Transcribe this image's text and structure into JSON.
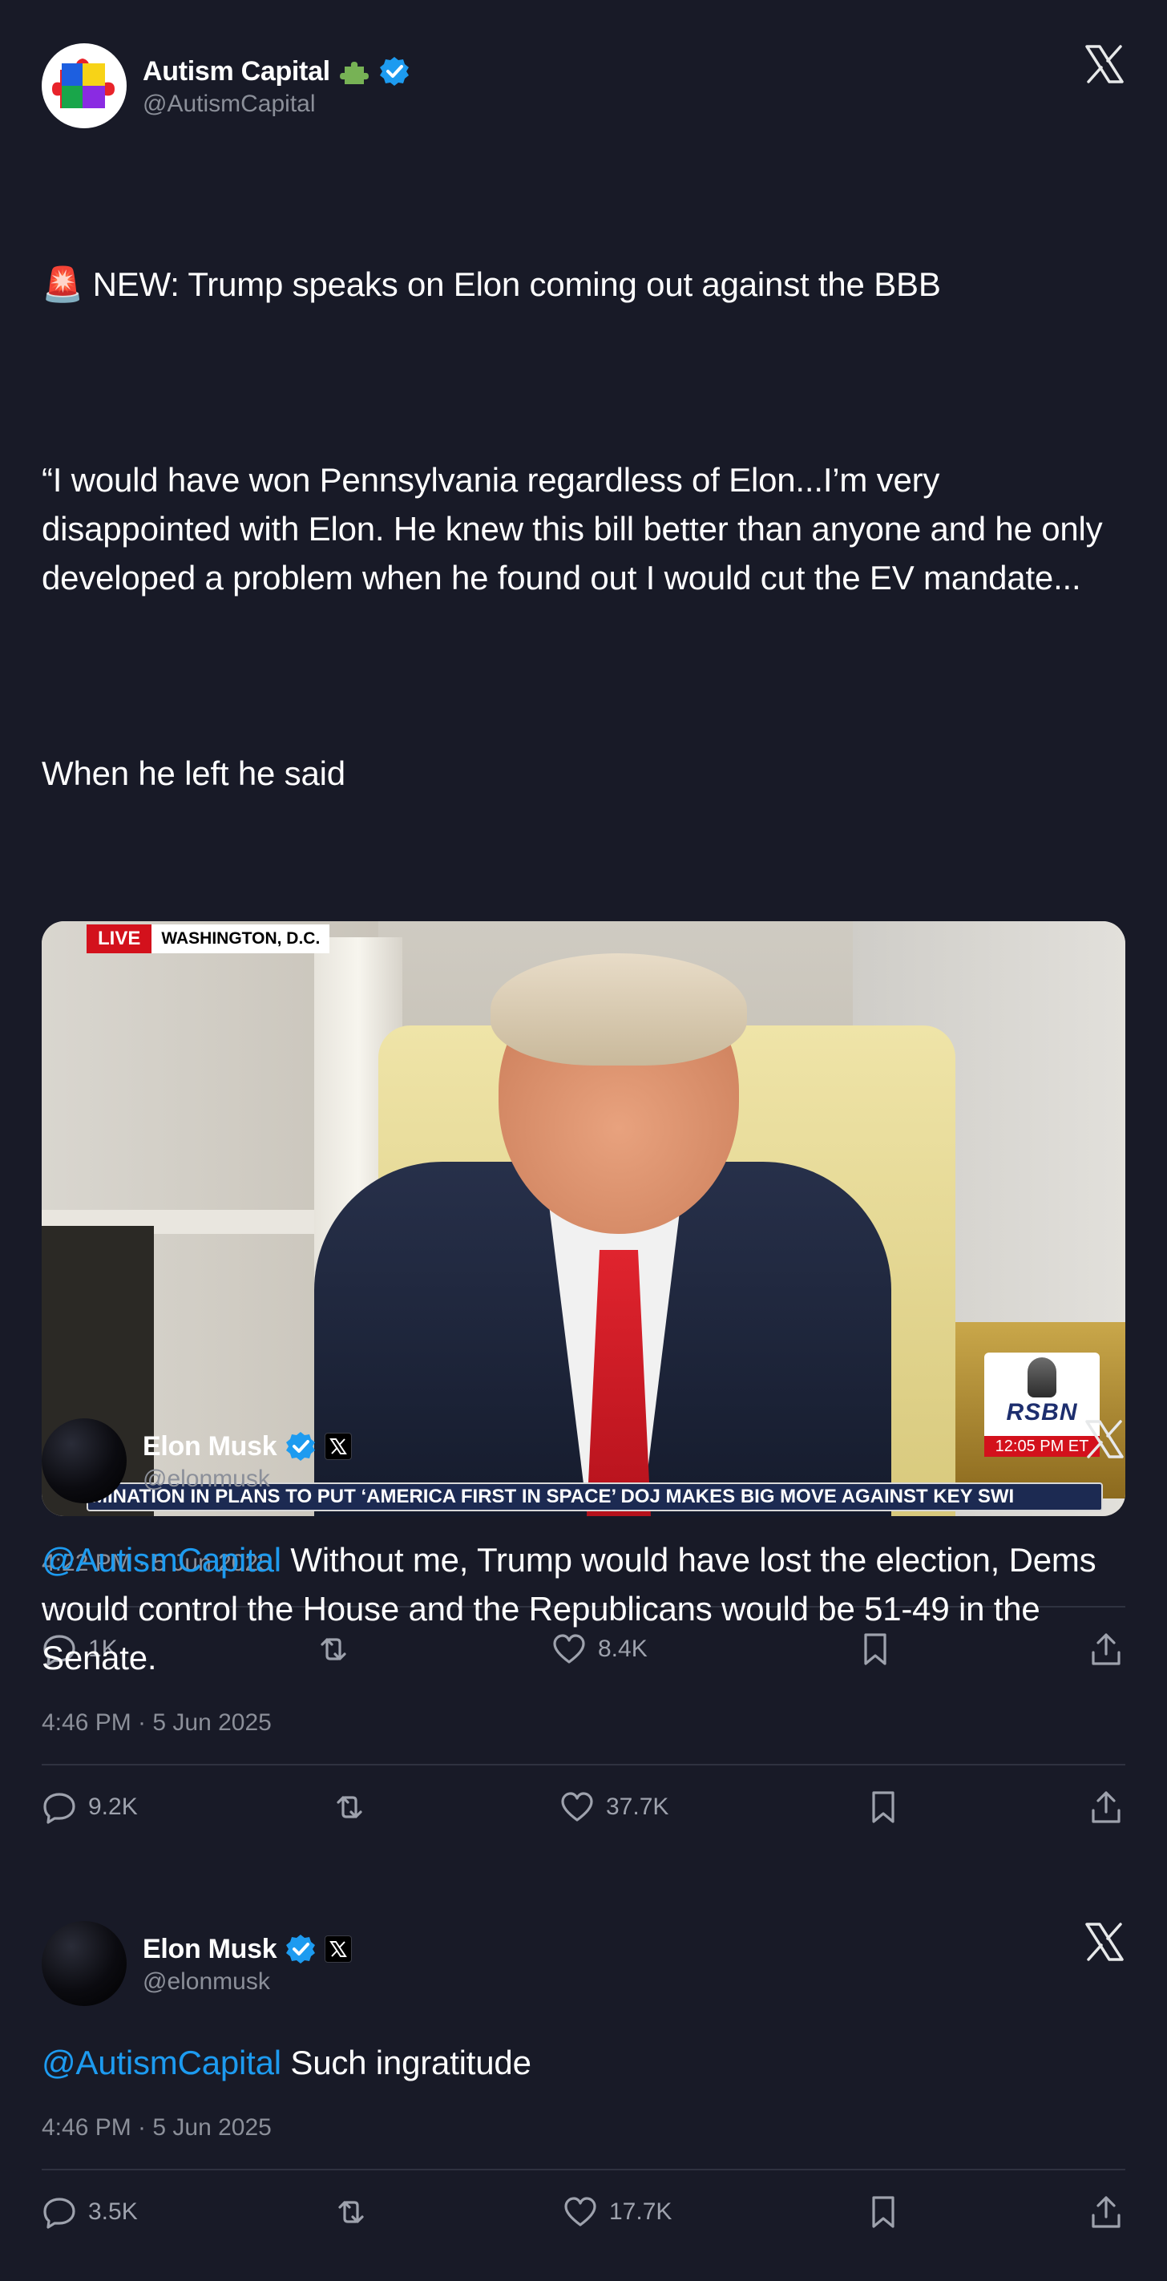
{
  "tweets": [
    {
      "name": "Autism Capital",
      "handle": "@AutismCapital",
      "badges": [
        "puzzle-piece-emoji",
        "verified-badge"
      ],
      "emoji": "🚨",
      "lines": {
        "l1": "NEW: Trump speaks on Elon coming out against the BBB",
        "l2": "“I would have won Pennsylvania regardless of Elon...I’m very disappointed with Elon. He knew this bill better than anyone and he only developed a problem when he found out I would cut the EV mandate...",
        "l3": "When he left he said"
      },
      "media": {
        "live_label": "LIVE",
        "location": "WASHINGTON, D.C.",
        "ticker": "MINATION IN PLANS TO PUT ‘AMERICA FIRST IN SPACE’    DOJ MAKES BIG MOVE AGAINST KEY SWI",
        "logo": "RSBN",
        "clock": "12:05 PM ET"
      },
      "timestamp": "4:22 PM · 5 Jun 2025",
      "replies": "1K",
      "retweets": "",
      "likes": "8.4K"
    },
    {
      "name": "Elon Musk",
      "handle": "@elonmusk",
      "mention": "@AutismCapital",
      "text": " Without me, Trump would have lost the election, Dems would control the House and the Republicans would be 51-49 in the Senate.",
      "timestamp": "4:46 PM · 5 Jun 2025",
      "replies": "9.2K",
      "retweets": "",
      "likes": "37.7K"
    },
    {
      "name": "Elon Musk",
      "handle": "@elonmusk",
      "mention": "@AutismCapital",
      "text": " Such ingratitude",
      "timestamp": "4:46 PM · 5 Jun 2025",
      "replies": "3.5K",
      "retweets": "",
      "likes": "17.7K"
    }
  ],
  "colors": {
    "background": "#181a27",
    "text": "#ffffff",
    "secondary": "#8b8f99",
    "mention": "#1d9bf0",
    "verified": "#1d9bf0",
    "divider": "#2f3240"
  }
}
